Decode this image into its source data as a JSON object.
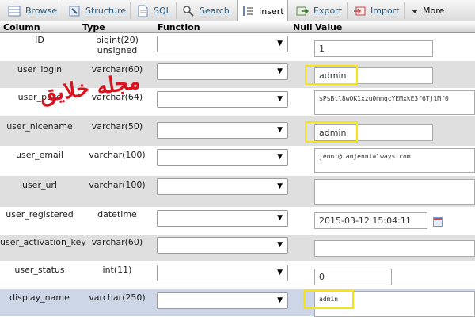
{
  "tabs": [
    {
      "label": "Browse",
      "icon": "browse-icon"
    },
    {
      "label": "Structure",
      "icon": "structure-icon"
    },
    {
      "label": "SQL",
      "icon": "sql-icon"
    },
    {
      "label": "Search",
      "icon": "search-icon"
    },
    {
      "label": "Insert",
      "icon": "insert-icon",
      "active": true
    },
    {
      "label": "Export",
      "icon": "export-icon"
    },
    {
      "label": "Import",
      "icon": "import-icon"
    },
    {
      "label": "More",
      "icon": "more-dropdown-icon"
    }
  ],
  "headers": {
    "column": "Column",
    "type": "Type",
    "function": "Function",
    "null": "Null",
    "value": "Value"
  },
  "fields": [
    {
      "name": "ID",
      "type": "bigint(20) unsigned",
      "value": "1"
    },
    {
      "name": "user_login",
      "type": "varchar(60)",
      "value": "admin",
      "highlighted": true
    },
    {
      "name": "user_pass",
      "type": "varchar(64)",
      "value": "$P$Btl8wOK1xzu0mmqcYEMxkE3f6Tj1Mf0"
    },
    {
      "name": "user_nicename",
      "type": "varchar(50)",
      "value": "admin",
      "highlighted": true
    },
    {
      "name": "user_email",
      "type": "varchar(100)",
      "value": "jenni@iamjennialways.com"
    },
    {
      "name": "user_url",
      "type": "varchar(100)",
      "value": ""
    },
    {
      "name": "user_registered",
      "type": "datetime",
      "value": "2015-03-12 15:04:11"
    },
    {
      "name": "user_activation_key",
      "type": "varchar(60)",
      "value": ""
    },
    {
      "name": "user_status",
      "type": "int(11)",
      "value": "0"
    },
    {
      "name": "display_name",
      "type": "varchar(250)",
      "value": "admin",
      "highlighted": true
    }
  ],
  "watermark": "مجله خلایق",
  "colors": {
    "tab_link": "#235a81",
    "row_alt": "#dfdfdf",
    "row_selected": "#ccd6e7",
    "highlight": "#f3e31d",
    "watermark": "#d9141f"
  }
}
